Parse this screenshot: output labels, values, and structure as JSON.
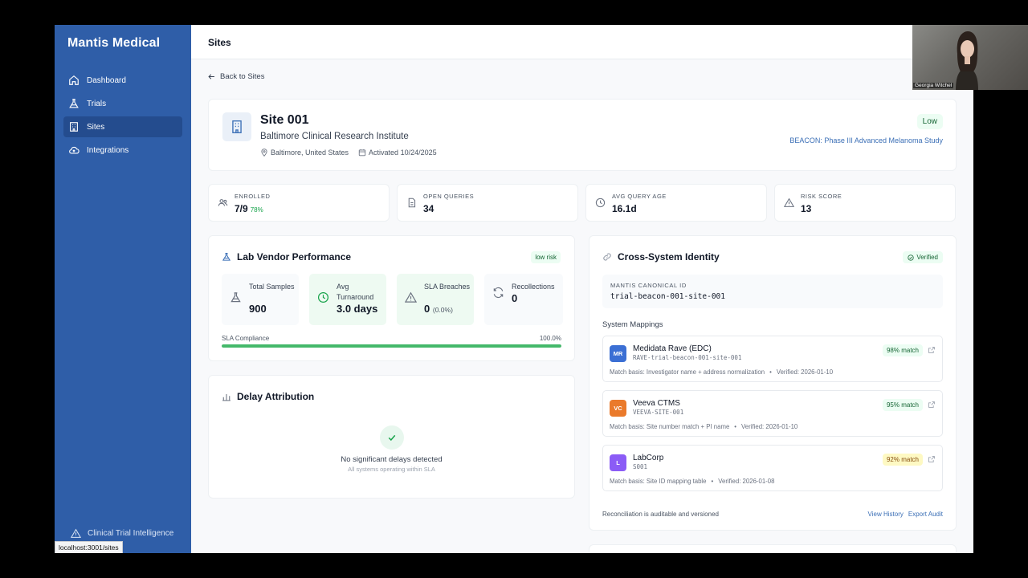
{
  "sidebar": {
    "brand": "Mantis Medical",
    "items": [
      {
        "label": "Dashboard",
        "icon": "home-icon"
      },
      {
        "label": "Trials",
        "icon": "flask-icon"
      },
      {
        "label": "Sites",
        "icon": "building-icon",
        "active": true
      },
      {
        "label": "Integrations",
        "icon": "cloud-icon"
      }
    ],
    "footer": "Clinical Trial Intelligence"
  },
  "status_url": "localhost:3001/sites",
  "header": {
    "title": "Sites"
  },
  "back_link": "Back to Sites",
  "site": {
    "title": "Site 001",
    "name": "Baltimore Clinical Research Institute",
    "location": "Baltimore, United States",
    "activated": "Activated 10/24/2025",
    "risk": "Low",
    "study": "BEACON: Phase III Advanced Melanoma Study"
  },
  "stats": [
    {
      "label": "ENROLLED",
      "value": "7/9",
      "sub": "78%"
    },
    {
      "label": "OPEN QUERIES",
      "value": "34"
    },
    {
      "label": "AVG QUERY AGE",
      "value": "16.1d"
    },
    {
      "label": "RISK SCORE",
      "value": "13"
    }
  ],
  "lab_vendor": {
    "title": "Lab Vendor Performance",
    "badge": "low risk",
    "metrics": [
      {
        "label": "Total Samples",
        "value": "900"
      },
      {
        "label": "Avg Turnaround",
        "value": "3.0 days"
      },
      {
        "label": "SLA Breaches",
        "value": "0",
        "sub": "(0.0%)"
      },
      {
        "label": "Recollections",
        "value": "0"
      }
    ],
    "sla_label": "SLA Compliance",
    "sla_value": "100.0%",
    "sla_fraction": 1.0
  },
  "delay": {
    "title": "Delay Attribution",
    "message": "No significant delays detected",
    "sub": "All systems operating within SLA"
  },
  "identity": {
    "title": "Cross-System Identity",
    "badge": "Verified",
    "canonical_label": "MANTIS CANONICAL ID",
    "canonical_id": "trial-beacon-001-site-001",
    "mappings_title": "System Mappings",
    "mappings": [
      {
        "abbr": "MR",
        "color": "#3b6fd4",
        "name": "Medidata Rave (EDC)",
        "code": "RAVE-trial-beacon-001-site-001",
        "match": "98% match",
        "match_tone": "green",
        "basis": "Match basis: Investigator name + address normalization",
        "verified": "Verified: 2026-01-10"
      },
      {
        "abbr": "VC",
        "color": "#ea7a2b",
        "name": "Veeva CTMS",
        "code": "VEEVA-SITE-001",
        "match": "95% match",
        "match_tone": "green",
        "basis": "Match basis: Site number match + PI name",
        "verified": "Verified: 2026-01-10"
      },
      {
        "abbr": "L",
        "color": "#8b5cf6",
        "name": "LabCorp",
        "code": "S001",
        "match": "92% match",
        "match_tone": "yellow",
        "basis": "Match basis: Site ID mapping table",
        "verified": "Verified: 2026-01-08"
      }
    ],
    "note": "Reconciliation is auditable and versioned",
    "links": [
      "View History",
      "Export Audit"
    ]
  },
  "video": {
    "name": "Georgia Witchel"
  },
  "colors": {
    "sidebar": "#2f5ea8",
    "accent": "#3b6fb6",
    "success": "#44b86a"
  }
}
